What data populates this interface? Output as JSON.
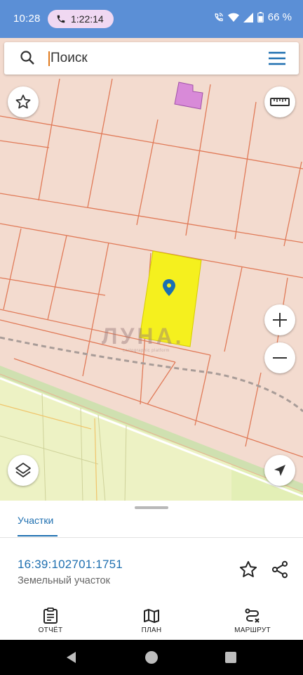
{
  "status_bar": {
    "time": "10:28",
    "call_duration": "1:22:14",
    "battery": "66 %"
  },
  "search": {
    "placeholder": "Поиск",
    "value": ""
  },
  "map": {
    "watermark": "ЛУНА.",
    "watermark_subtitle": "cartographic platform",
    "selected_parcel_color": "#f5f01e",
    "other_parcel_color": "#d88ad8",
    "marker_color": "#1a6fb3"
  },
  "sheet": {
    "tab_label": "Участки",
    "parcel_id": "16:39:102701:1751",
    "parcel_type": "Земельный участок"
  },
  "bottom_nav": {
    "items": [
      {
        "label": "ОТЧЁТ",
        "icon": "clipboard-icon"
      },
      {
        "label": "ПЛАН",
        "icon": "map-icon"
      },
      {
        "label": "МАРШРУТ",
        "icon": "route-icon"
      }
    ]
  },
  "colors": {
    "status_bar": "#5b8fd6",
    "accent": "#1e6fb0"
  }
}
